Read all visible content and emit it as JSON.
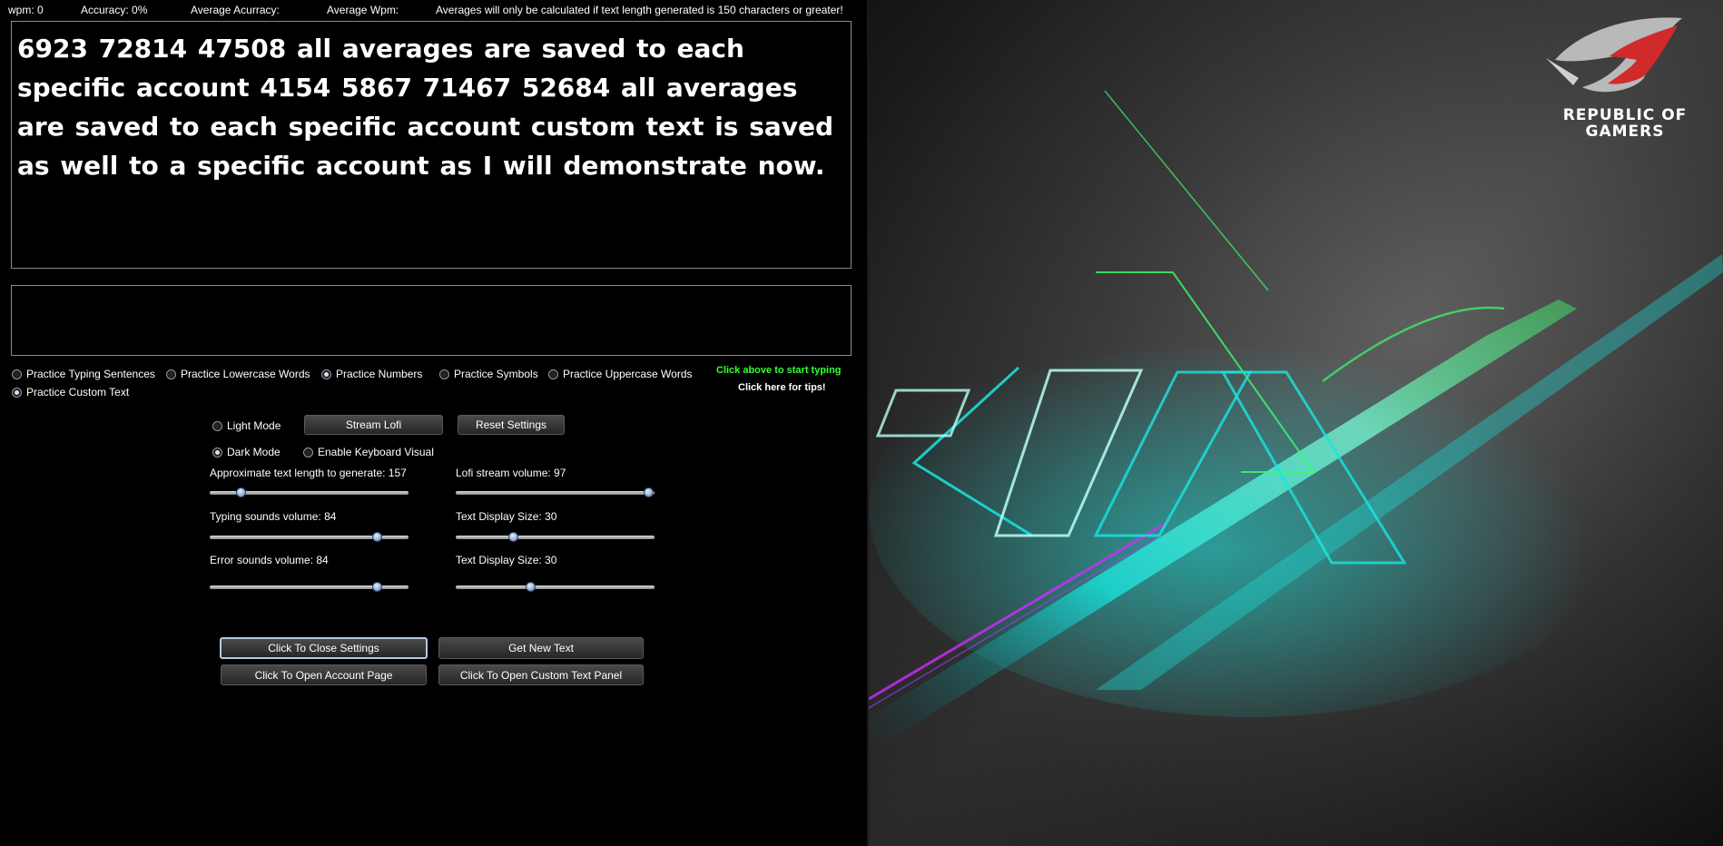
{
  "stats": {
    "wpm": "wpm: 0",
    "accuracy": "Accuracy: 0%",
    "avg_accuracy": "Average Acurracy:",
    "avg_wpm": "Average Wpm:",
    "notice": "Averages will only be calculated if text length generated is 150 characters or greater!"
  },
  "display_text": "6923 72814 47508 all averages are saved to each specific account 4154 5867 71467 52684 all averages are saved to each specific account custom  text is saved as well to a specific account as I will demonstrate now.",
  "modes": [
    {
      "label": "Practice Typing Sentences",
      "selected": false
    },
    {
      "label": "Practice Lowercase Words",
      "selected": false
    },
    {
      "label": "Practice Numbers",
      "selected": true
    },
    {
      "label": "Practice Symbols",
      "selected": false
    },
    {
      "label": "Practice Uppercase Words",
      "selected": false
    },
    {
      "label": "Practice Custom Text",
      "selected": true
    }
  ],
  "tips": {
    "start": "Click above to start typing",
    "help": "Click here for tips!"
  },
  "settings": {
    "light_mode": {
      "label": "Light Mode",
      "selected": false
    },
    "dark_mode": {
      "label": "Dark Mode",
      "selected": true
    },
    "keyboard_visual": {
      "label": "Enable Keyboard Visual",
      "selected": false
    },
    "stream_lofi": "Stream Lofi",
    "reset_settings": "Reset Settings",
    "sliders": [
      {
        "label": "Approximate text length to generate: 157",
        "value": 157,
        "min": 0,
        "max": 1000
      },
      {
        "label": "Lofi stream volume: 97",
        "value": 97,
        "min": 0,
        "max": 100
      },
      {
        "label": "Typing sounds volume: 84",
        "value": 84,
        "min": 0,
        "max": 100
      },
      {
        "label": "Text Display Size: 30",
        "value": 30,
        "min": 10,
        "max": 80
      },
      {
        "label": "Error sounds volume: 84",
        "value": 84,
        "min": 0,
        "max": 100
      },
      {
        "label": "Text Display Size: 30",
        "value": 30,
        "min": 0,
        "max": 80
      }
    ]
  },
  "buttons": {
    "close_settings": "Click To Close Settings",
    "get_new_text": "Get New Text",
    "open_account": "Click To Open Account Page",
    "open_custom": "Click To Open Custom Text Panel"
  },
  "wallpaper": {
    "brand_line1": "REPUBLIC OF",
    "brand_line2": "GAMERS",
    "colors": {
      "cyan": "#19e6e0",
      "green": "#3cff6a",
      "magenta": "#d02cff",
      "red": "#e23a3a"
    }
  }
}
